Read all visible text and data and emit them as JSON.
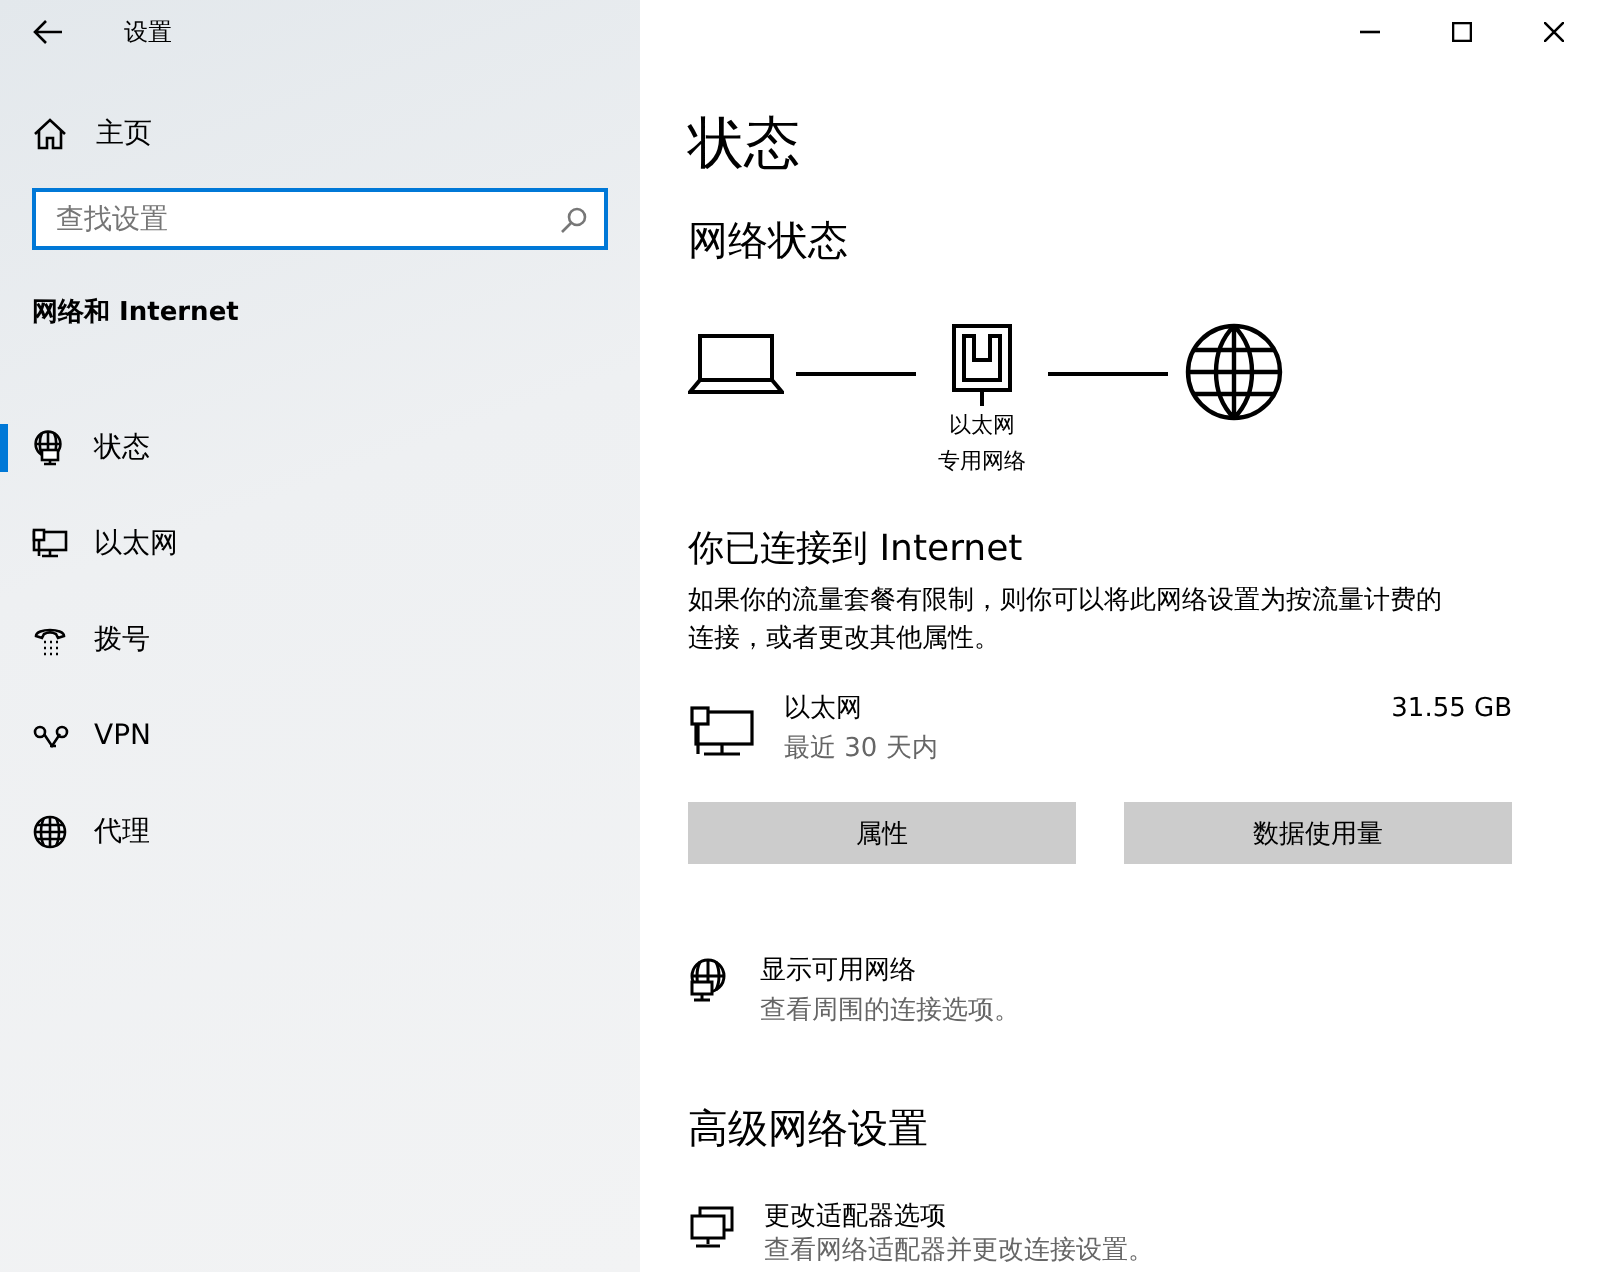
{
  "window": {
    "title": "设置"
  },
  "sidebar": {
    "home": "主页",
    "search": {
      "placeholder": "查找设置"
    },
    "section": "网络和 Internet",
    "items": [
      {
        "label": "状态",
        "selected": true
      },
      {
        "label": "以太网",
        "selected": false
      },
      {
        "label": "拨号",
        "selected": false
      },
      {
        "label": "VPN",
        "selected": false
      },
      {
        "label": "代理",
        "selected": false
      }
    ]
  },
  "main": {
    "title": "状态",
    "network_heading": "网络状态",
    "diagram": {
      "label": "以太网",
      "sublabel": "专用网络"
    },
    "connection_heading": "你已连接到 Internet",
    "description": "如果你的流量套餐有限制，则你可以将此网络设置为按流量计费的连接，或者更改其他属性。",
    "usage": {
      "name": "以太网",
      "period": "最近 30 天内",
      "amount": "31.55 GB"
    },
    "buttons": [
      "属性",
      "数据使用量"
    ],
    "show_networks": {
      "title": "显示可用网络",
      "subtitle": "查看周围的连接选项。"
    },
    "advanced_heading": "高级网络设置",
    "adapter": {
      "title": "更改适配器选项",
      "subtitle": "查看网络适配器并更改连接设置。"
    }
  }
}
